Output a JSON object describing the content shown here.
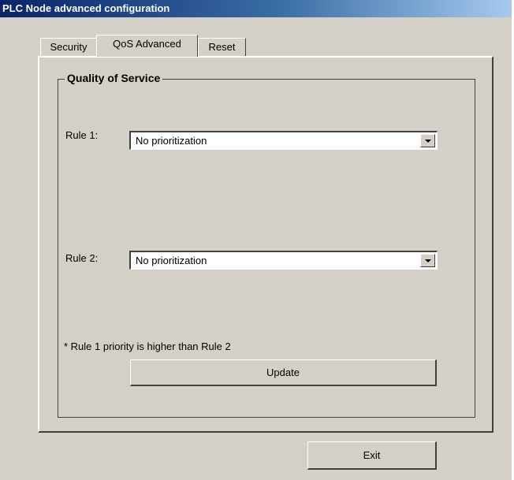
{
  "window": {
    "title": "PLC Node advanced configuration"
  },
  "tabs": [
    {
      "label": "Security",
      "selected": false
    },
    {
      "label": "QoS Advanced",
      "selected": true
    },
    {
      "label": "Reset",
      "selected": false
    }
  ],
  "qos": {
    "group_title": "Quality of Service",
    "rule1": {
      "label": "Rule 1:",
      "value": "No prioritization"
    },
    "rule2": {
      "label": "Rule 2:",
      "value": "No prioritization"
    },
    "note": "* Rule 1 priority is higher than Rule 2",
    "update_label": "Update"
  },
  "exit_label": "Exit"
}
